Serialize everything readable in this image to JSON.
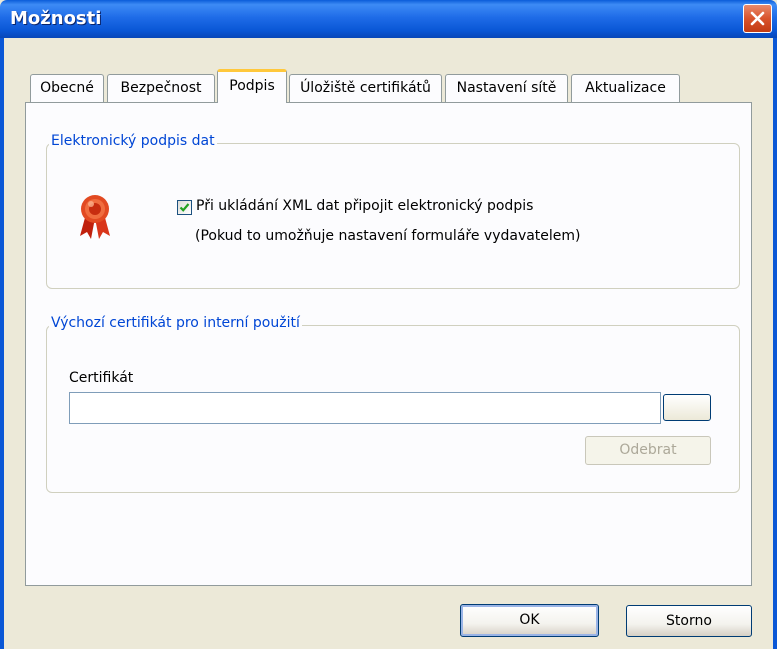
{
  "window": {
    "title": "Možnosti"
  },
  "tabs": [
    {
      "label": "Obecné"
    },
    {
      "label": "Bezpečnost"
    },
    {
      "label": "Podpis"
    },
    {
      "label": "Úložiště certifikátů"
    },
    {
      "label": "Nastavení sítě"
    },
    {
      "label": "Aktualizace"
    }
  ],
  "active_tab": "Podpis",
  "signature_group": {
    "legend": "Elektronický podpis dat",
    "checkbox_label": "Při ukládání XML dat připojit elektronický podpis",
    "checkbox_checked": true,
    "note": "(Pokud to umožňuje nastavení formuláře vydavatelem)",
    "icon": "award-ribbon-icon"
  },
  "certificate_group": {
    "legend": "Výchozí certifikát pro interní použití",
    "field_label": "Certifikát",
    "field_value": "",
    "browse_label": "",
    "remove_label": "Odebrat"
  },
  "buttons": {
    "ok": "OK",
    "cancel": "Storno"
  },
  "colors": {
    "titlebar": "#0a57d6",
    "legend_text": "#0046d5",
    "active_tab_accent": "#ffc83c",
    "close_button": "#d9532c"
  }
}
